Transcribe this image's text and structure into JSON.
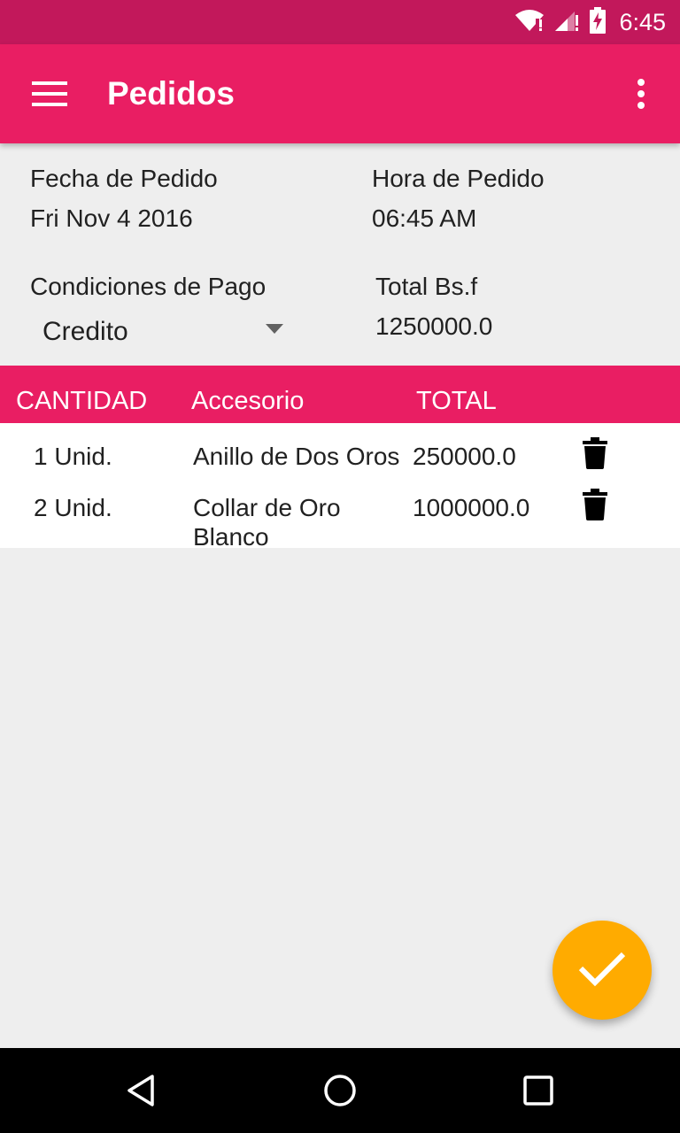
{
  "status_bar": {
    "time": "6:45"
  },
  "app_bar": {
    "title": "Pedidos"
  },
  "order": {
    "date_label": "Fecha de Pedido",
    "date_value": "Fri Nov 4 2016",
    "time_label": "Hora de Pedido",
    "time_value": "06:45 AM",
    "payment_label": "Condiciones de Pago",
    "payment_value": "Credito",
    "total_label": "Total Bs.f",
    "total_value": "1250000.0"
  },
  "table": {
    "headers": [
      "CANTIDAD",
      "Accesorio",
      "TOTAL"
    ],
    "rows": [
      {
        "quantity": "1 Unid.",
        "item": "Anillo de Dos Oros",
        "total": "250000.0"
      },
      {
        "quantity": "2 Unid.",
        "item": "Collar de Oro Blanco",
        "total": "1000000.0"
      }
    ]
  },
  "icons": {
    "menu": "menu-icon",
    "overflow": "more-vert-icon",
    "delete": "trash-icon",
    "confirm": "check-icon",
    "nav_back": "back-triangle-icon",
    "nav_home": "home-circle-icon",
    "nav_recents": "recents-square-icon"
  },
  "colors": {
    "status_bar": "#c2185b",
    "primary": "#e91e63",
    "fab": "#ffab00",
    "background": "#eeeeee"
  }
}
